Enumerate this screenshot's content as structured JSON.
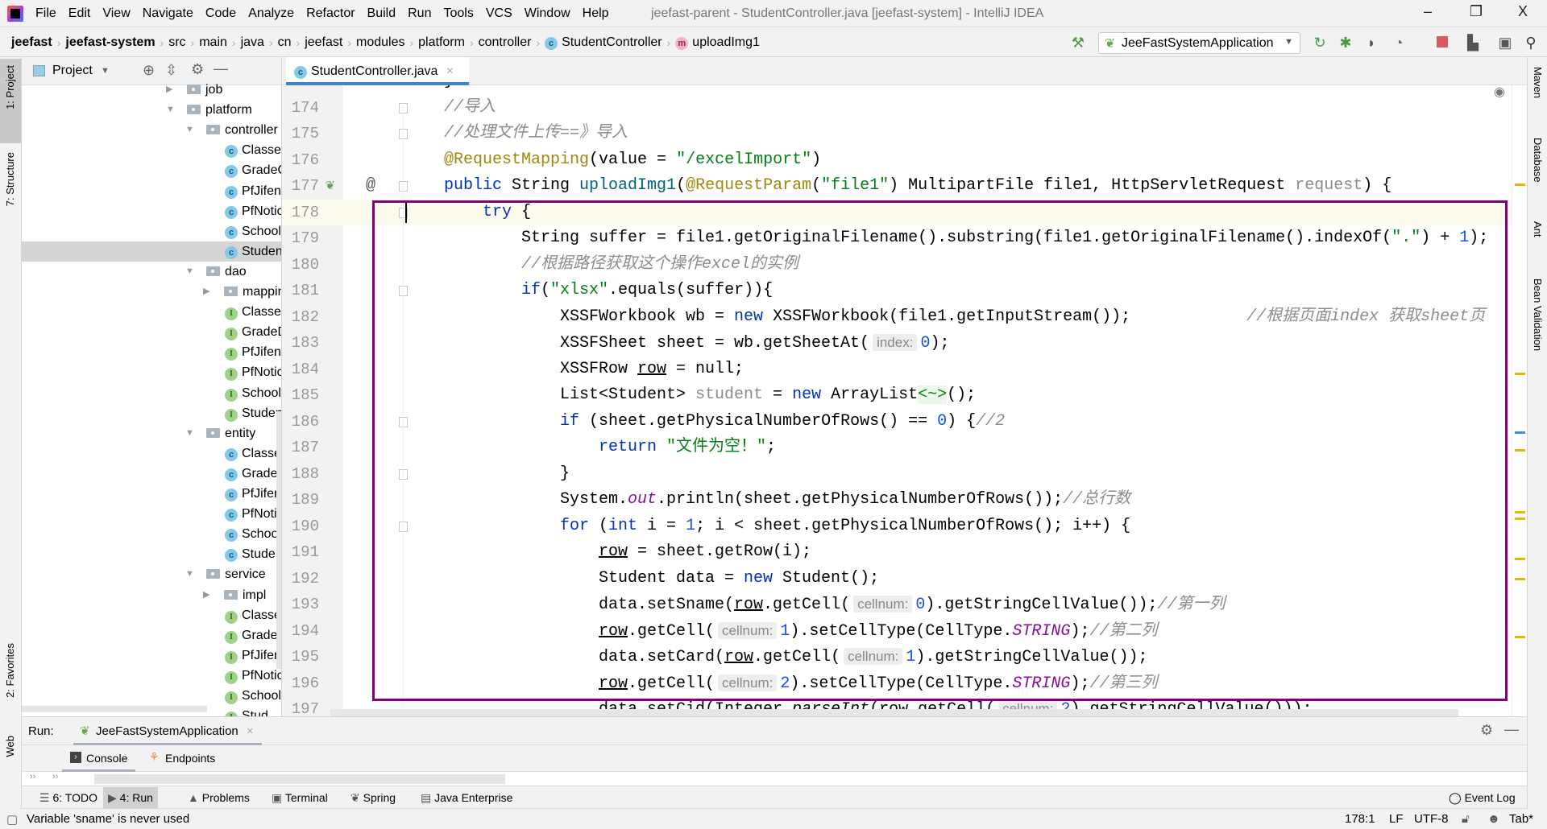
{
  "title_bar": {
    "menu": [
      "File",
      "Edit",
      "View",
      "Navigate",
      "Code",
      "Analyze",
      "Refactor",
      "Build",
      "Run",
      "Tools",
      "VCS",
      "Window",
      "Help"
    ],
    "window_title": "jeefast-parent - StudentController.java [jeefast-system] - IntelliJ IDEA",
    "minimize": "–",
    "restore": "❐",
    "close": "X"
  },
  "breadcrumb": [
    "jeefast",
    "jeefast-system",
    "src",
    "main",
    "java",
    "cn",
    "jeefast",
    "modules",
    "platform",
    "controller",
    "StudentController",
    "uploadImg1"
  ],
  "toolbar": {
    "run_config": "JeeFastSystemApplication",
    "icons": [
      "hammer-icon",
      "rerun-icon",
      "debug-icon",
      "coverage-icon",
      "profile-icon",
      "stop-icon",
      "project-structure-icon",
      "terminal-icon",
      "search-icon"
    ]
  },
  "left_strip": {
    "project": "1: Project",
    "structure": "7: Structure",
    "favorites": "2: Favorites",
    "web": "Web"
  },
  "right_strip": {
    "maven": "Maven",
    "database": "Database",
    "ant": "Ant",
    "bean_validation": "Bean Validation"
  },
  "project_panel": {
    "title": "Project",
    "tree": [
      {
        "label": "job",
        "type": "folder",
        "level": 1,
        "expanded": false
      },
      {
        "label": "platform",
        "type": "folder",
        "level": 1,
        "expanded": true
      },
      {
        "label": "controller",
        "type": "folder",
        "level": 2,
        "expanded": true
      },
      {
        "label": "Classes",
        "type": "class",
        "level": 3
      },
      {
        "label": "GradeC",
        "type": "class",
        "level": 3
      },
      {
        "label": "PfJifen",
        "type": "class",
        "level": 3
      },
      {
        "label": "PfNotic",
        "type": "class",
        "level": 3
      },
      {
        "label": "School",
        "type": "class",
        "level": 3
      },
      {
        "label": "Studen",
        "type": "class",
        "level": 3,
        "selected": true
      },
      {
        "label": "dao",
        "type": "folder",
        "level": 2,
        "expanded": true
      },
      {
        "label": "mappin",
        "type": "folder",
        "level": 3,
        "expanded": false
      },
      {
        "label": "Classes",
        "type": "interface",
        "level": 3
      },
      {
        "label": "GradeD",
        "type": "interface",
        "level": 3
      },
      {
        "label": "PfJifenI",
        "type": "interface",
        "level": 3
      },
      {
        "label": "PfNotic",
        "type": "interface",
        "level": 3
      },
      {
        "label": "School",
        "type": "interface",
        "level": 3
      },
      {
        "label": "Studen",
        "type": "interface",
        "level": 3
      },
      {
        "label": "entity",
        "type": "folder",
        "level": 2,
        "expanded": true
      },
      {
        "label": "Classes",
        "type": "class",
        "level": 3
      },
      {
        "label": "Grade",
        "type": "class",
        "level": 3
      },
      {
        "label": "PfJifen",
        "type": "class",
        "level": 3
      },
      {
        "label": "PfNotic",
        "type": "class",
        "level": 3
      },
      {
        "label": "School",
        "type": "class",
        "level": 3
      },
      {
        "label": "Studen",
        "type": "class",
        "level": 3
      },
      {
        "label": "service",
        "type": "folder",
        "level": 2,
        "expanded": true
      },
      {
        "label": "impl",
        "type": "folder",
        "level": 3,
        "expanded": false
      },
      {
        "label": "Classes",
        "type": "interface",
        "level": 3
      },
      {
        "label": "GradeS",
        "type": "interface",
        "level": 3
      },
      {
        "label": "PfJifenS",
        "type": "interface",
        "level": 3
      },
      {
        "label": "PfNotic",
        "type": "interface",
        "level": 3
      },
      {
        "label": "School",
        "type": "interface",
        "level": 3
      },
      {
        "label": "Stud",
        "type": "interface",
        "level": 3
      }
    ]
  },
  "editor": {
    "tab": "StudentController.java",
    "current_line": 178,
    "lines": [
      {
        "n": 173,
        "i": 1,
        "s": [
          [
            "}",
            ""
          ]
        ]
      },
      {
        "n": 174,
        "i": 1,
        "fold": true,
        "s": [
          [
            "//导入",
            "cm"
          ]
        ]
      },
      {
        "n": 175,
        "i": 1,
        "fold": true,
        "s": [
          [
            "//处理文件上传==》导入",
            "cm"
          ]
        ]
      },
      {
        "n": 176,
        "i": 1,
        "s": [
          [
            "@RequestMapping",
            "ann"
          ],
          [
            "(value = ",
            ""
          ],
          [
            "\"/excelImport\"",
            "str"
          ],
          [
            ")",
            ""
          ]
        ]
      },
      {
        "n": 177,
        "i": 1,
        "fold": true,
        "bean": true,
        "s": [
          [
            "public",
            "kw"
          ],
          [
            " String ",
            ""
          ],
          [
            "uploadImg1",
            "fn"
          ],
          [
            "(",
            ""
          ],
          [
            "@RequestParam",
            "ann"
          ],
          [
            "(",
            ""
          ],
          [
            "\"file1\"",
            "str"
          ],
          [
            ") MultipartFile file1, HttpServletRequest ",
            ""
          ],
          [
            "request",
            "gray"
          ],
          [
            ") {",
            ""
          ]
        ]
      },
      {
        "n": 178,
        "i": 2,
        "fold": true,
        "s": [
          [
            "try",
            "kw"
          ],
          [
            " {",
            ""
          ]
        ]
      },
      {
        "n": 179,
        "i": 3,
        "s": [
          [
            "String suffer = file1.getOriginalFilename().substring(file1.getOriginalFilename().indexOf(",
            ""
          ],
          [
            "\".\"",
            "str"
          ],
          [
            ") + ",
            ""
          ],
          [
            "1",
            "num"
          ],
          [
            ");",
            ""
          ]
        ]
      },
      {
        "n": 180,
        "i": 3,
        "s": [
          [
            "//根据路径获取这个操作excel的实例",
            "cm"
          ]
        ]
      },
      {
        "n": 181,
        "i": 3,
        "fold": true,
        "s": [
          [
            "if",
            "kw"
          ],
          [
            "(",
            ""
          ],
          [
            "\"xlsx\"",
            "str"
          ],
          [
            ".equals(suffer)){",
            ""
          ]
        ]
      },
      {
        "n": 182,
        "i": 4,
        "s": [
          [
            "XSSFWorkbook wb = ",
            ""
          ],
          [
            "new",
            "kw"
          ],
          [
            " XSSFWorkbook(file1.getInputStream());",
            ""
          ],
          [
            "            //根据页面index 获取sheet页",
            "cm"
          ]
        ]
      },
      {
        "n": 183,
        "i": 4,
        "s": [
          [
            "XSSFSheet sheet = wb.getSheetAt(",
            ""
          ],
          [
            "index:",
            "hint"
          ],
          [
            "0",
            "num"
          ],
          [
            ");",
            ""
          ]
        ]
      },
      {
        "n": 184,
        "i": 4,
        "s": [
          [
            "XSSFRow ",
            ""
          ],
          [
            "row",
            "ul"
          ],
          [
            " = null;",
            ""
          ]
        ]
      },
      {
        "n": 185,
        "i": 4,
        "s": [
          [
            "List<Student> ",
            ""
          ],
          [
            "student",
            "gray"
          ],
          [
            " = ",
            ""
          ],
          [
            "new",
            "kw"
          ],
          [
            " ArrayList",
            ""
          ],
          [
            "<~>",
            "dia"
          ],
          [
            "();",
            ""
          ]
        ]
      },
      {
        "n": 186,
        "i": 4,
        "fold": true,
        "s": [
          [
            "if",
            "kw"
          ],
          [
            " (sheet.getPhysicalNumberOfRows() == ",
            ""
          ],
          [
            "0",
            "num"
          ],
          [
            ") {",
            ""
          ],
          [
            "//2",
            "cm"
          ]
        ]
      },
      {
        "n": 187,
        "i": 5,
        "s": [
          [
            "return",
            "kw"
          ],
          [
            " ",
            ""
          ],
          [
            "\"文件为空！\"",
            "str"
          ],
          [
            ";",
            ""
          ]
        ]
      },
      {
        "n": 188,
        "i": 4,
        "fold": true,
        "s": [
          [
            "}",
            ""
          ]
        ]
      },
      {
        "n": 189,
        "i": 4,
        "s": [
          [
            "System.",
            ""
          ],
          [
            "out",
            "st"
          ],
          [
            ".println(sheet.getPhysicalNumberOfRows());",
            ""
          ],
          [
            "//总行数",
            "cm"
          ]
        ]
      },
      {
        "n": 190,
        "i": 4,
        "fold": true,
        "s": [
          [
            "for",
            "kw"
          ],
          [
            " (",
            ""
          ],
          [
            "int",
            "kw"
          ],
          [
            " i = ",
            ""
          ],
          [
            "1",
            "num"
          ],
          [
            "; i < sheet.getPhysicalNumberOfRows(); i++) {",
            ""
          ]
        ]
      },
      {
        "n": 191,
        "i": 5,
        "s": [
          [
            "row",
            "ul"
          ],
          [
            " = sheet.getRow(i);",
            ""
          ]
        ]
      },
      {
        "n": 192,
        "i": 5,
        "s": [
          [
            "Student data = ",
            ""
          ],
          [
            "new",
            "kw"
          ],
          [
            " Student();",
            ""
          ]
        ]
      },
      {
        "n": 193,
        "i": 5,
        "s": [
          [
            "data.setSname(",
            ""
          ],
          [
            "row",
            "ul"
          ],
          [
            ".getCell(",
            ""
          ],
          [
            "cellnum:",
            "hint"
          ],
          [
            "0",
            "num"
          ],
          [
            ").getStringCellValue());",
            ""
          ],
          [
            "//第一列",
            "cm"
          ]
        ]
      },
      {
        "n": 194,
        "i": 5,
        "s": [
          [
            "row",
            "ul"
          ],
          [
            ".getCell(",
            ""
          ],
          [
            "cellnum:",
            "hint"
          ],
          [
            "1",
            "num"
          ],
          [
            ").setCellType(CellType.",
            ""
          ],
          [
            "STRING",
            "st"
          ],
          [
            ");",
            ""
          ],
          [
            "//第二列",
            "cm"
          ]
        ]
      },
      {
        "n": 195,
        "i": 5,
        "s": [
          [
            "data.setCard(",
            ""
          ],
          [
            "row",
            "ul"
          ],
          [
            ".getCell(",
            ""
          ],
          [
            "cellnum:",
            "hint"
          ],
          [
            "1",
            "num"
          ],
          [
            ").getStringCellValue());",
            ""
          ]
        ]
      },
      {
        "n": 196,
        "i": 5,
        "s": [
          [
            "row",
            "ul"
          ],
          [
            ".getCell(",
            ""
          ],
          [
            "cellnum:",
            "hint"
          ],
          [
            "2",
            "num"
          ],
          [
            ").setCellType(CellType.",
            ""
          ],
          [
            "STRING",
            "st"
          ],
          [
            ");",
            ""
          ],
          [
            "//第三列",
            "cm"
          ]
        ]
      },
      {
        "n": 197,
        "i": 5,
        "s": [
          [
            "data.setCid(Integer.",
            ""
          ],
          [
            "parseInt",
            "it"
          ],
          [
            "(",
            ""
          ],
          [
            "row",
            "ul"
          ],
          [
            ".getCell(",
            ""
          ],
          [
            "cellnum:",
            "hint"
          ],
          [
            "2",
            "num"
          ],
          [
            ").getStringCellValue()));",
            ""
          ]
        ]
      }
    ]
  },
  "run_panel": {
    "label": "Run:",
    "config": "JeeFastSystemApplication",
    "tabs": [
      "Console",
      "Endpoints"
    ]
  },
  "tool_tabs": [
    "6: TODO",
    "4: Run",
    "Problems",
    "Terminal",
    "Spring",
    "Java Enterprise"
  ],
  "event_log": "Event Log",
  "status": {
    "message": "Variable 'sname' is never used",
    "position": "178:1",
    "line_sep": "LF",
    "encoding": "UTF-8",
    "indent": "Tab*"
  },
  "colors": {
    "highlight_box": "#800080",
    "keyword": "#0033b3",
    "string": "#067d17",
    "tab_underline": "#4083c9"
  }
}
